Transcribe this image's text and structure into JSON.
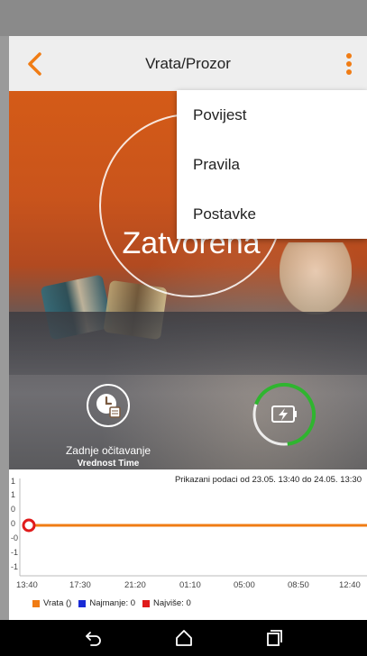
{
  "header": {
    "title": "Vrata/Prozor"
  },
  "menu": {
    "items": [
      "Povijest",
      "Pravila",
      "Postavke"
    ]
  },
  "device": {
    "status": "Zatvorena",
    "last_reading_label": "Zadnje očitavanje",
    "last_reading_value": "Vrednost Time"
  },
  "chart": {
    "info": "Prikazani podaci od 23.05. 13:40 do 24.05. 13:30",
    "y_ticks": [
      "1",
      "1",
      "0",
      "0",
      "-0",
      "-1",
      "-1"
    ],
    "x_ticks": [
      "13:40",
      "17:30",
      "21:20",
      "01:10",
      "05:00",
      "08:50",
      "12:40"
    ],
    "legend": {
      "vrata": "Vrata ()",
      "min": "Najmanje: 0",
      "max": "Najviše: 0"
    }
  },
  "chart_data": {
    "type": "line",
    "x": [
      "13:40",
      "17:30",
      "21:20",
      "01:10",
      "05:00",
      "08:50",
      "12:40"
    ],
    "series": [
      {
        "name": "Vrata ()",
        "values": [
          0,
          0,
          0,
          0,
          0,
          0,
          0
        ]
      }
    ],
    "title": "Prikazani podaci od 23.05. 13:40 do 24.05. 13:30",
    "ylim": [
      -1,
      1
    ],
    "legend_position": "bottom-left"
  },
  "colors": {
    "accent": "#f07c14",
    "series": "#f07c14",
    "min": "#1a2bd6",
    "max": "#e01b1b",
    "battery_ring": "#2fb52f"
  },
  "icons": {
    "back": "chevron-left-icon",
    "more": "more-vertical-icon",
    "clock": "clock-calendar-icon",
    "battery": "battery-charging-icon",
    "nav_back": "back-arrow-icon",
    "nav_home": "home-icon",
    "nav_recents": "recents-icon"
  }
}
